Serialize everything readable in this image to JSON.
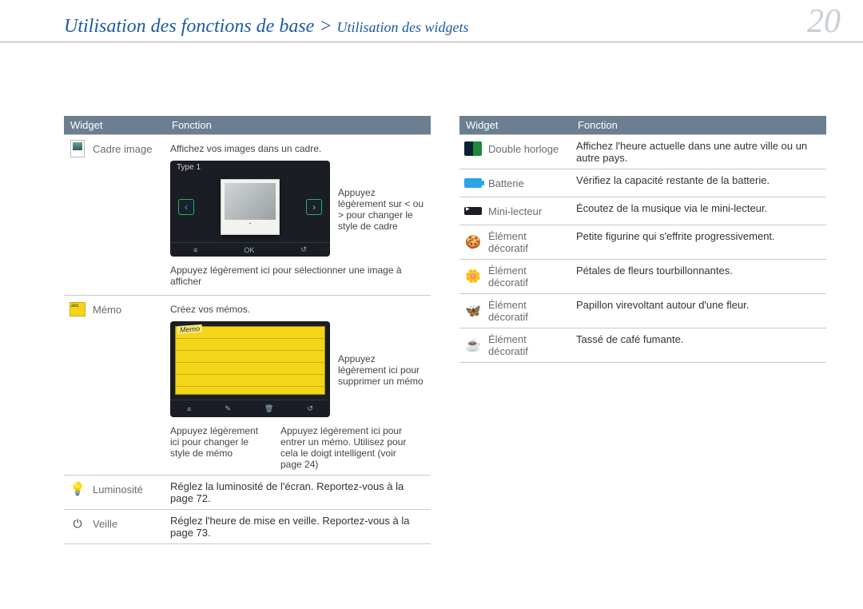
{
  "header": {
    "breadcrumb_main": "Utilisation des fonctions de base",
    "breadcrumb_sep": " > ",
    "breadcrumb_sub": "Utilisation des widgets",
    "page_number": "20"
  },
  "tableHeaders": {
    "widget": "Widget",
    "fonction": "Fonction"
  },
  "left": {
    "cadre": {
      "name": "Cadre image",
      "intro": "Affichez vos images dans un cadre.",
      "shot_type": "Type 1",
      "shot_ok": "OK",
      "callout_nav": "Appuyez légèrement sur < ou > pour changer le style de cadre",
      "callout_sel": "Appuyez légèrement ici pour sélectionner une image à afficher"
    },
    "memo": {
      "name": "Mémo",
      "intro": "Créez vos mémos.",
      "callout_delete": "Appuyez légèrement ici pour supprimer un mémo",
      "callout_style": "Appuyez légèrement ici pour changer le style de mémo",
      "callout_enter": "Appuyez légèrement ici pour entrer un mémo. Utilisez pour cela le doigt intelligent (voir page 24)"
    },
    "luminosite": {
      "name": "Luminosité",
      "desc": "Réglez la luminosité de l'écran. Reportez-vous à la page 72."
    },
    "veille": {
      "name": "Veille",
      "desc": "Réglez l'heure de mise en veille. Reportez-vous à la page 73."
    }
  },
  "right": [
    {
      "name": "Double horloge",
      "desc": "Affichez l'heure actuelle dans une autre ville ou un autre pays.",
      "iconClass": "ico-dh"
    },
    {
      "name": "Batterie",
      "desc": "Vérifiez la capacité restante de la batterie.",
      "iconClass": "ico-batt"
    },
    {
      "name": "Mini-lecteur",
      "desc": "Écoutez de la musique via le mini-lecteur.",
      "iconClass": "ico-mini"
    },
    {
      "name": "Élément décoratif",
      "desc": "Petite figurine qui s'effrite progressivement.",
      "iconGlyph": "🍪"
    },
    {
      "name": "Élément décoratif",
      "desc": "Pétales de fleurs tourbillonnantes.",
      "iconGlyph": "🌼"
    },
    {
      "name": "Élément décoratif",
      "desc": "Papillon virevoltant autour d'une fleur.",
      "iconGlyph": "🦋"
    },
    {
      "name": "Élément décoratif",
      "desc": "Tassé de café fumante.",
      "iconGlyph": "☕"
    }
  ]
}
